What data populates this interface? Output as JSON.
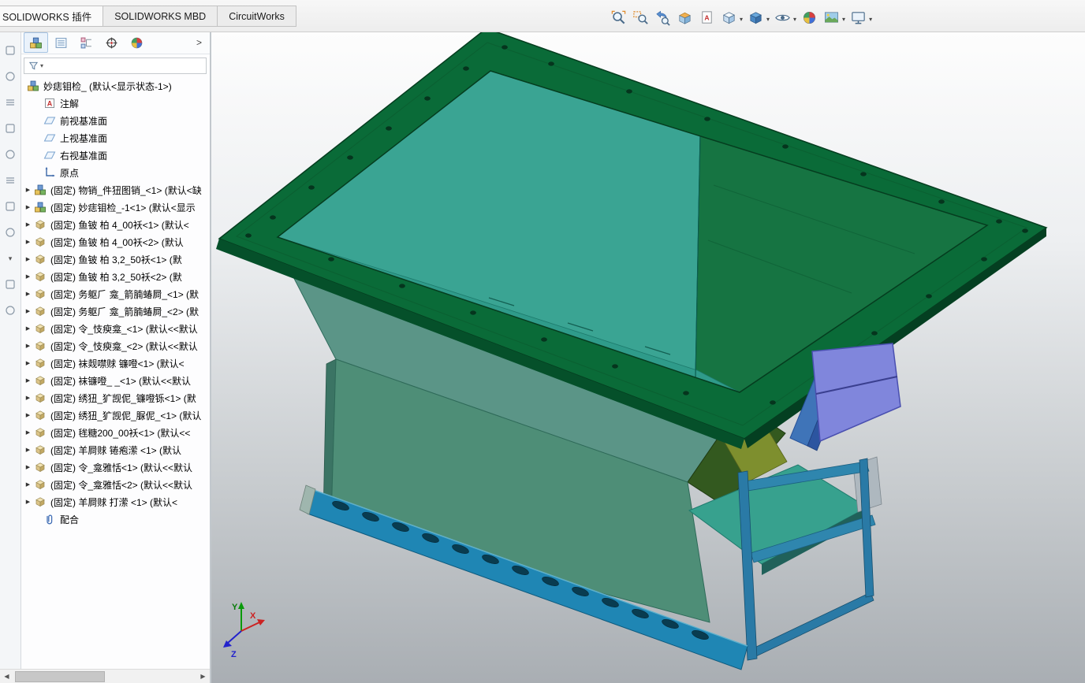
{
  "header": {
    "tabs": [
      {
        "label": "SOLIDWORKS 插件",
        "active": true
      },
      {
        "label": "SOLIDWORKS MBD",
        "active": false
      },
      {
        "label": "CircuitWorks",
        "active": false
      }
    ],
    "headsup_icons": [
      {
        "name": "zoom-to-fit",
        "dropdown": false
      },
      {
        "name": "zoom-to-area",
        "dropdown": false
      },
      {
        "name": "previous-view",
        "dropdown": false
      },
      {
        "name": "section-view",
        "dropdown": false
      },
      {
        "name": "dynamic-annotation-views",
        "dropdown": false
      },
      {
        "name": "view-orientation",
        "dropdown": true
      },
      {
        "name": "display-style",
        "dropdown": true
      },
      {
        "name": "hide-show-items",
        "dropdown": true
      },
      {
        "name": "edit-appearance",
        "dropdown": false
      },
      {
        "name": "apply-scene",
        "dropdown": true
      },
      {
        "name": "view-settings",
        "dropdown": true
      }
    ]
  },
  "left_dock": {
    "chevron_glyph": "▾",
    "icons": [
      "dock-tool-1",
      "dock-tool-2",
      "dock-tool-3",
      "dock-tool-4",
      "dock-tool-5",
      "dock-tool-6",
      "dock-tool-7",
      "dock-tool-8",
      "dock-expand-chevron",
      "dock-tool-9",
      "dock-tool-10"
    ]
  },
  "feature_panel": {
    "tabs": [
      "featuremanager-design-tree",
      "propertymanager",
      "configurationmanager",
      "dimxpertmanager",
      "displaymanager"
    ],
    "panel_overflow_chevron": ">",
    "expand_arrow": "▶",
    "collapse_arrow": "▼",
    "scrollbar": {
      "left_arrow": "◀",
      "right_arrow": "▶"
    },
    "tree": [
      {
        "type": "assembly",
        "label": "妙痣钼检_ (默认<显示状态-1>)",
        "level": 0,
        "expandable": false
      },
      {
        "type": "annotation",
        "label": "注解",
        "level": 1,
        "expandable": false
      },
      {
        "type": "plane",
        "label": "前视基准面",
        "level": 1,
        "expandable": false
      },
      {
        "type": "plane",
        "label": "上视基准面",
        "level": 1,
        "expandable": false
      },
      {
        "type": "plane",
        "label": "右视基准面",
        "level": 1,
        "expandable": false
      },
      {
        "type": "origin",
        "label": "原点",
        "level": 1,
        "expandable": false
      },
      {
        "type": "assembly",
        "label": "(固定) 物销_件狃图销_<1> (默认<缺",
        "level": 1,
        "expandable": true
      },
      {
        "type": "assembly",
        "label": "(固定) 妙痣钼检_-1<1> (默认<显示",
        "level": 1,
        "expandable": true
      },
      {
        "type": "part",
        "label": "(固定) 鱼铍 柏 4_00袄<1> (默认<",
        "level": 1,
        "expandable": true
      },
      {
        "type": "part",
        "label": "(固定) 鱼铍 柏 4_00袄<2> (默认",
        "level": 1,
        "expandable": true
      },
      {
        "type": "part",
        "label": "(固定) 鱼铍 柏 3,2_50袄<1> (默",
        "level": 1,
        "expandable": true
      },
      {
        "type": "part",
        "label": "(固定) 鱼铍 柏 3,2_50袄<2> (默",
        "level": 1,
        "expandable": true
      },
      {
        "type": "part",
        "label": "(固定) 务躯⺁ 龛_箭腩蝽屙_<1> (默",
        "level": 1,
        "expandable": true
      },
      {
        "type": "part",
        "label": "(固定) 务躯⺁ 龛_箭腩蝽屙_<2> (默",
        "level": 1,
        "expandable": true
      },
      {
        "type": "part",
        "label": "(固定) 令_忮瘐龛_<1> (默认<<默认",
        "level": 1,
        "expandable": true
      },
      {
        "type": "part",
        "label": "(固定) 令_忮瘐龛_<2> (默认<<默认",
        "level": 1,
        "expandable": true
      },
      {
        "type": "part",
        "label": "(固定) 袜觌噤赇 镰噔<1> (默认<",
        "level": 1,
        "expandable": true
      },
      {
        "type": "part",
        "label": "(固定) 袜镰噔_ _<1> (默认<<默认",
        "level": 1,
        "expandable": true
      },
      {
        "type": "part",
        "label": "(固定) 绣狃_犷觊伲_镰噔铄<1> (默",
        "level": 1,
        "expandable": true
      },
      {
        "type": "part",
        "label": "(固定) 绣狃_犷觊伲_脲伲_<1> (默认",
        "level": 1,
        "expandable": true
      },
      {
        "type": "part",
        "label": "(固定) 毪糖200_00袄<1> (默认<<",
        "level": 1,
        "expandable": true
      },
      {
        "type": "part",
        "label": "(固定) 羊屙赇 锩疱潆   <1> (默认",
        "level": 1,
        "expandable": true
      },
      {
        "type": "part",
        "label": "(固定) 令_龛雅恬<1> (默认<<默认",
        "level": 1,
        "expandable": true
      },
      {
        "type": "part",
        "label": "(固定) 令_龛雅恬<2> (默认<<默认",
        "level": 1,
        "expandable": true
      },
      {
        "type": "part",
        "label": "(固定) 羊屙赇 打潆  <1> (默认<",
        "level": 1,
        "expandable": true
      },
      {
        "type": "mates",
        "label": "配合",
        "level": 1,
        "expandable": false
      }
    ]
  },
  "viewport": {
    "triad": {
      "x": "X",
      "y": "Y",
      "z": "Z"
    },
    "model_colors": {
      "flange_green": "#0a6b38",
      "interior_teal": "#3aa493",
      "interior_green": "#167442",
      "taper_teal": "#5b9587",
      "body_teal": "#4e8e77",
      "chute_teal": "#37a18e",
      "base_rail_blue": "#1f86b4",
      "frame_blue": "#2e86b0",
      "spout_purple": "#8086dc",
      "duct_blue": "#3f74b8",
      "accent_yellow_green": "#7e8f2e",
      "triad_x": "#cc2222",
      "triad_y": "#0a9a0a",
      "triad_z": "#2222cc"
    }
  }
}
